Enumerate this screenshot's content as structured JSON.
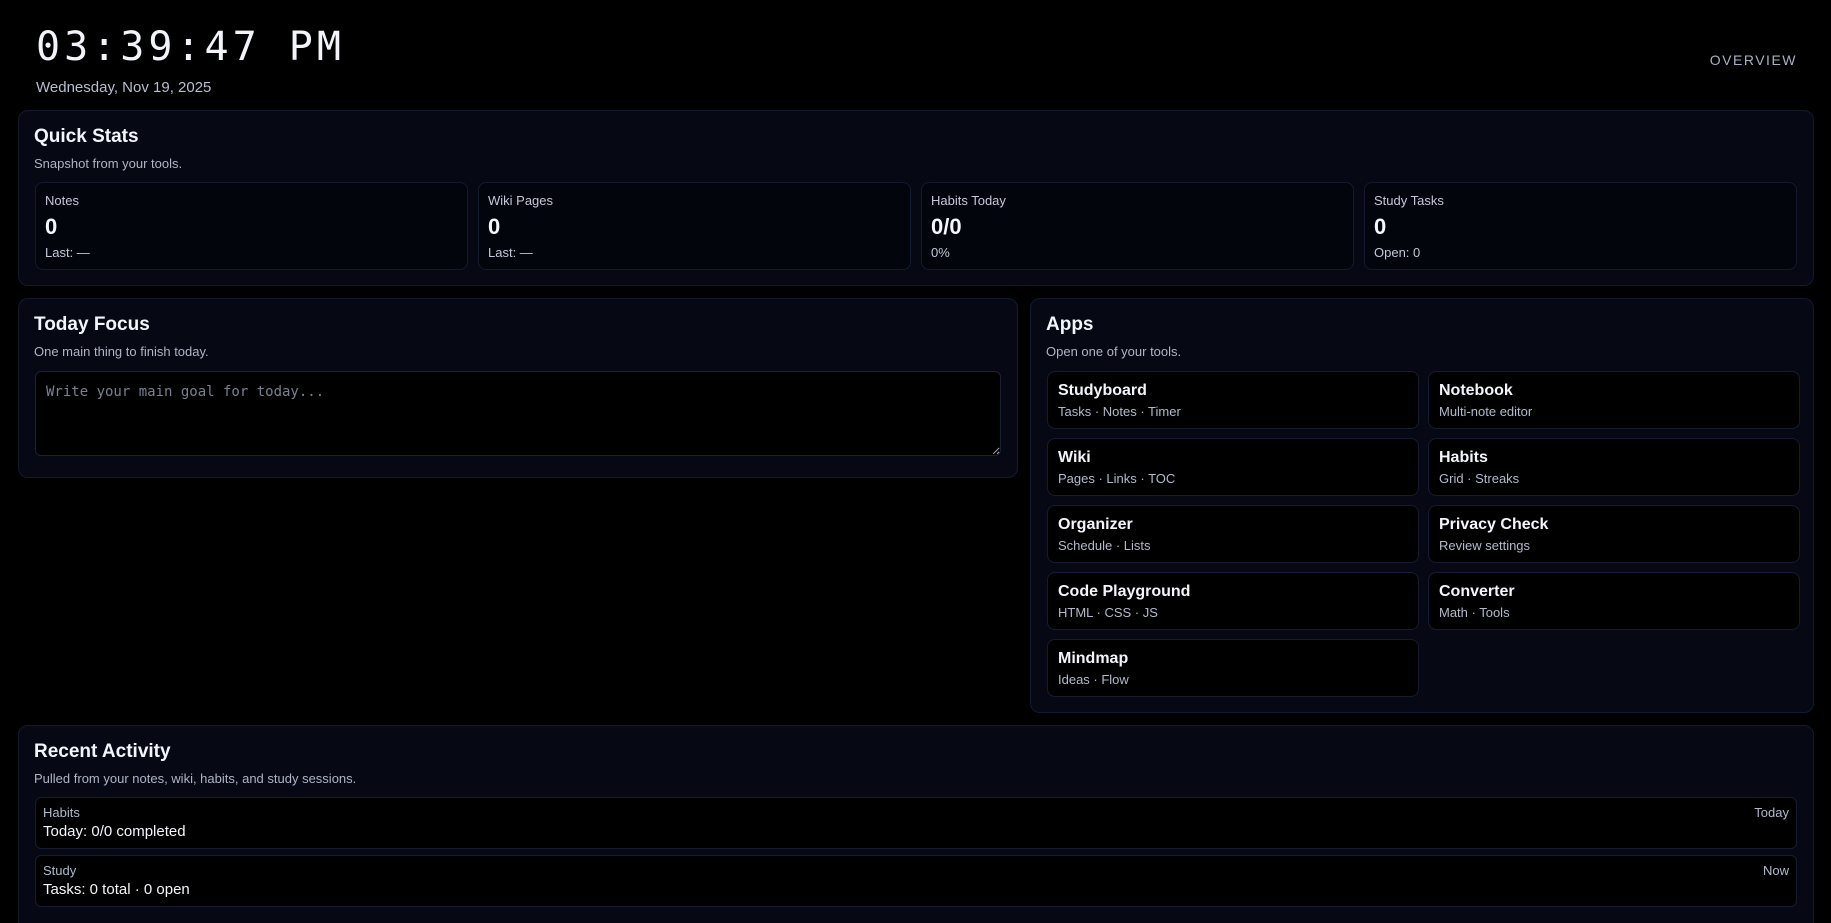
{
  "header": {
    "clock": "03:39:47 PM",
    "date": "Wednesday, Nov 19, 2025",
    "overview_label": "OVERVIEW"
  },
  "quick_stats": {
    "title": "Quick Stats",
    "subtitle": "Snapshot from your tools.",
    "items": [
      {
        "label": "Notes",
        "value": "0",
        "foot": "Last: —"
      },
      {
        "label": "Wiki Pages",
        "value": "0",
        "foot": "Last: —"
      },
      {
        "label": "Habits Today",
        "value": "0/0",
        "foot": "0%"
      },
      {
        "label": "Study Tasks",
        "value": "0",
        "foot": "Open: 0"
      }
    ]
  },
  "today_focus": {
    "title": "Today Focus",
    "subtitle": "One main thing to finish today.",
    "placeholder": "Write your main goal for today...",
    "value": ""
  },
  "apps": {
    "title": "Apps",
    "subtitle": "Open one of your tools.",
    "items": [
      {
        "name": "Studyboard",
        "desc": "Tasks · Notes · Timer"
      },
      {
        "name": "Notebook",
        "desc": "Multi-note editor"
      },
      {
        "name": "Wiki",
        "desc": "Pages · Links · TOC"
      },
      {
        "name": "Habits",
        "desc": "Grid · Streaks"
      },
      {
        "name": "Organizer",
        "desc": "Schedule · Lists"
      },
      {
        "name": "Privacy Check",
        "desc": "Review settings"
      },
      {
        "name": "Code Playground",
        "desc": "HTML · CSS · JS"
      },
      {
        "name": "Converter",
        "desc": "Math · Tools"
      },
      {
        "name": "Mindmap",
        "desc": "Ideas · Flow"
      }
    ]
  },
  "recent_activity": {
    "title": "Recent Activity",
    "subtitle": "Pulled from your notes, wiki, habits, and study sessions.",
    "items": [
      {
        "category": "Habits",
        "text": "Today: 0/0 completed",
        "time": "Today"
      },
      {
        "category": "Study",
        "text": "Tasks: 0 total · 0 open",
        "time": "Now"
      }
    ]
  }
}
